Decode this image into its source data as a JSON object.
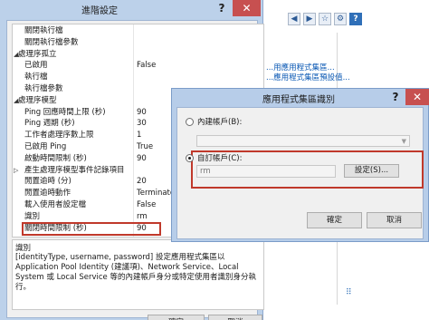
{
  "background": {
    "toolbar_icons": [
      "back-icon",
      "forward-icon",
      "star-icon",
      "gear-icon",
      "help-icon"
    ],
    "links": [
      "...用應用程式集區...",
      "...應用程式集區預設值..."
    ],
    "bottom_icon": "resize-grip-icon"
  },
  "advanced": {
    "title": "進階設定",
    "help_glyph": "?",
    "close_glyph": "✕",
    "rows": [
      {
        "name": "關閉執行檔",
        "value": "",
        "cat": false,
        "toggle": ""
      },
      {
        "name": "關閉執行檔參數",
        "value": "",
        "cat": false,
        "toggle": ""
      },
      {
        "name": "處理序孤立",
        "value": "",
        "cat": true,
        "toggle": "◢"
      },
      {
        "name": "已啟用",
        "value": "False",
        "cat": false,
        "toggle": ""
      },
      {
        "name": "執行檔",
        "value": "",
        "cat": false,
        "toggle": ""
      },
      {
        "name": "執行檔參數",
        "value": "",
        "cat": false,
        "toggle": ""
      },
      {
        "name": "處理序模型",
        "value": "",
        "cat": true,
        "toggle": "◢"
      },
      {
        "name": "Ping 回應時間上限 (秒)",
        "value": "90",
        "cat": false,
        "toggle": ""
      },
      {
        "name": "Ping 週期 (秒)",
        "value": "30",
        "cat": false,
        "toggle": ""
      },
      {
        "name": "工作者處理序數上限",
        "value": "1",
        "cat": false,
        "toggle": ""
      },
      {
        "name": "已啟用 Ping",
        "value": "True",
        "cat": false,
        "toggle": ""
      },
      {
        "name": "啟動時間限制 (秒)",
        "value": "90",
        "cat": false,
        "toggle": ""
      },
      {
        "name": "產生處理序模型事件記錄項目",
        "value": "",
        "cat": false,
        "toggle": "▷"
      },
      {
        "name": "閒置逾時 (分)",
        "value": "20",
        "cat": false,
        "toggle": ""
      },
      {
        "name": "閒置逾時動作",
        "value": "Terminate",
        "cat": false,
        "toggle": ""
      },
      {
        "name": "載入使用者設定檔",
        "value": "False",
        "cat": false,
        "toggle": ""
      },
      {
        "name": "識別",
        "value": "rm",
        "cat": false,
        "toggle": ""
      },
      {
        "name": "關閉時間限制 (秒)",
        "value": "90",
        "cat": false,
        "toggle": ""
      }
    ],
    "desc_title": "識別",
    "desc_text": "[identityType, username, password] 設定應用程式集區以 Application Pool Identity (建議項)、Network Service、Local System 或 Local Service 等的內建帳戶身分或特定使用者識別身分執行。",
    "ok_label": "確定",
    "cancel_label": "取消"
  },
  "dialog": {
    "title": "應用程式集區識別",
    "help_glyph": "?",
    "close_glyph": "✕",
    "builtin_label": "內建帳戶(B):",
    "builtin_value": "",
    "custom_label": "自訂帳戶(C):",
    "account_value": "rm",
    "set_label": "設定(S)...",
    "ok_label": "確定",
    "cancel_label": "取消",
    "selected": "custom"
  }
}
